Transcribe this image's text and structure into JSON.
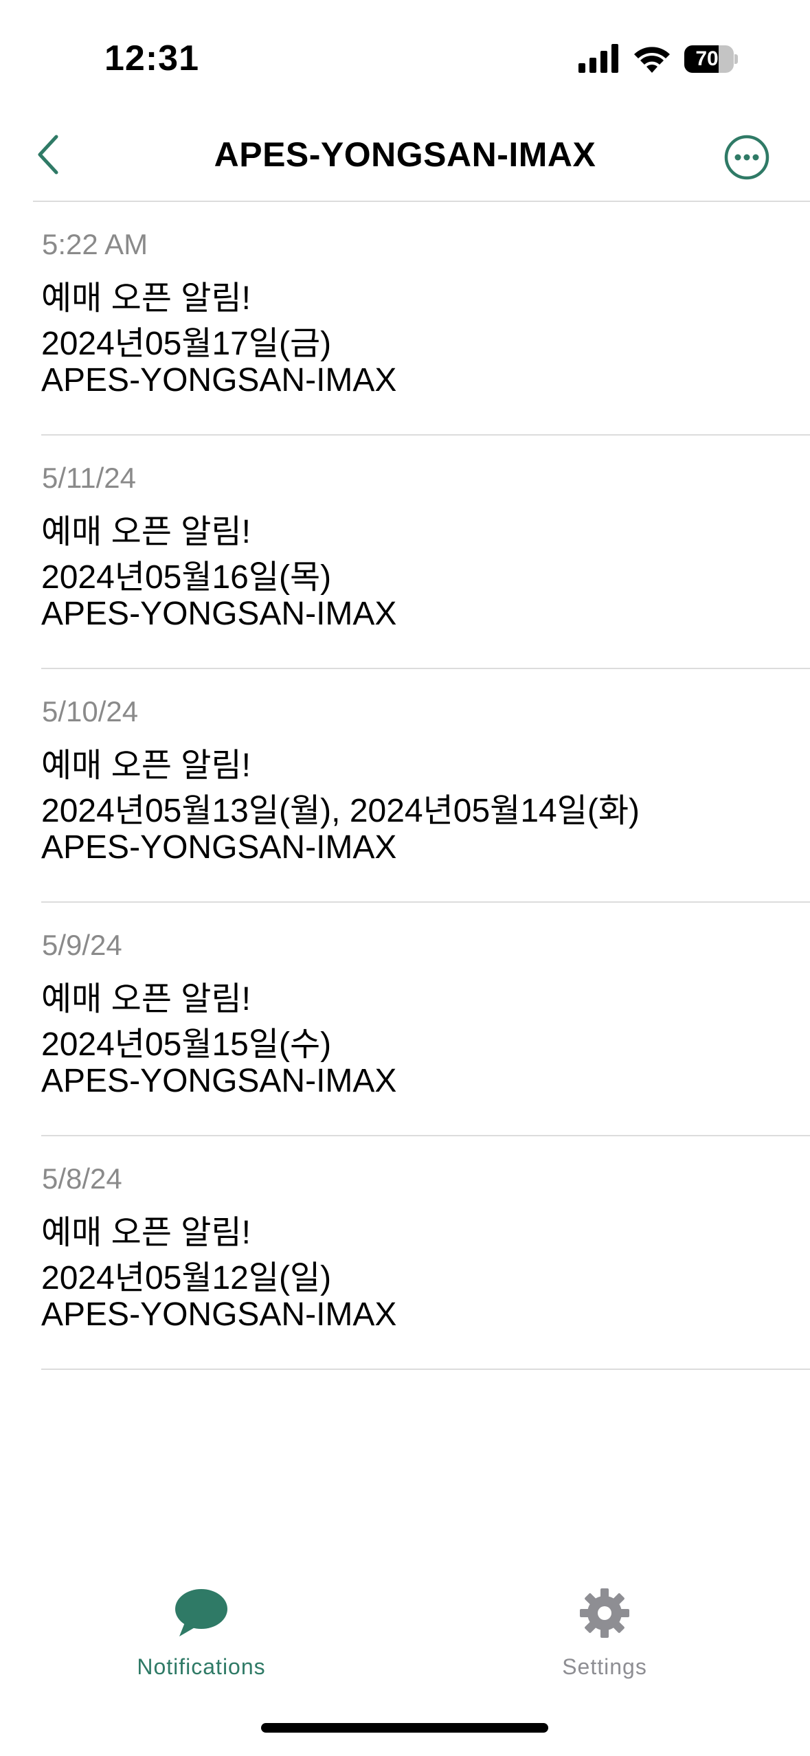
{
  "status_bar": {
    "time": "12:31",
    "battery_level": "70",
    "battery_fraction": 0.7,
    "icons": [
      "signal-icon",
      "wifi-icon",
      "battery-icon"
    ]
  },
  "nav": {
    "title": "APES-YONGSAN-IMAX",
    "back_icon": "chevron-left-icon",
    "more_icon": "ellipsis-circle-icon",
    "accent_color": "#2f7a66"
  },
  "notifications": [
    {
      "time": "5:22 AM",
      "line1": "예매 오픈 알림!",
      "line2": "2024년05월17일(금)",
      "line3": "APES-YONGSAN-IMAX"
    },
    {
      "time": "5/11/24",
      "line1": "예매 오픈 알림!",
      "line2": "2024년05월16일(목)",
      "line3": "APES-YONGSAN-IMAX"
    },
    {
      "time": "5/10/24",
      "line1": "예매 오픈 알림!",
      "line2": "2024년05월13일(월), 2024년05월14일(화)",
      "line3": "APES-YONGSAN-IMAX"
    },
    {
      "time": "5/9/24",
      "line1": "예매 오픈 알림!",
      "line2": "2024년05월15일(수)",
      "line3": "APES-YONGSAN-IMAX"
    },
    {
      "time": "5/8/24",
      "line1": "예매 오픈 알림!",
      "line2": "2024년05월12일(일)",
      "line3": "APES-YONGSAN-IMAX"
    }
  ],
  "tab_bar": {
    "tabs": [
      {
        "label": "Notifications",
        "icon": "chat-bubble-icon",
        "active": true,
        "color": "#2f7a66"
      },
      {
        "label": "Settings",
        "icon": "gear-icon",
        "active": false,
        "color": "#8e8e93"
      }
    ]
  }
}
